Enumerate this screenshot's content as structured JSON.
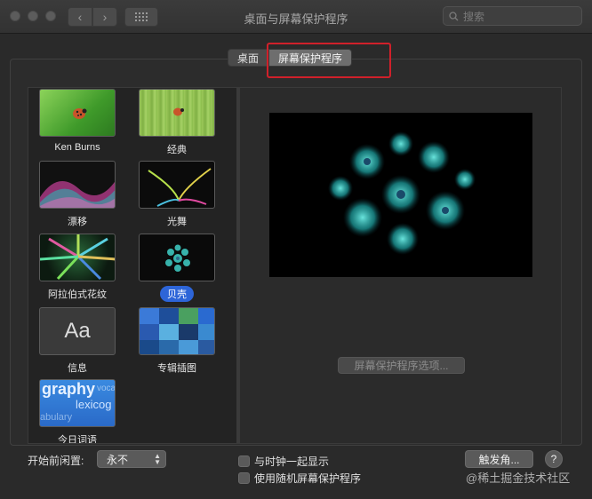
{
  "window": {
    "title": "桌面与屏幕保护程序",
    "search_placeholder": "搜索"
  },
  "tabs": [
    {
      "label": "桌面",
      "selected": false
    },
    {
      "label": "屏幕保护程序",
      "selected": true
    }
  ],
  "screensavers": [
    {
      "label": "Ken Burns",
      "selected": false
    },
    {
      "label": "经典",
      "selected": false
    },
    {
      "label": "漂移",
      "selected": false
    },
    {
      "label": "光舞",
      "selected": false
    },
    {
      "label": "阿拉伯式花纹",
      "selected": false
    },
    {
      "label": "贝壳",
      "selected": true
    },
    {
      "label": "信息",
      "selected": false
    },
    {
      "label": "专辑插图",
      "selected": false
    },
    {
      "label": "今日词语",
      "selected": false
    }
  ],
  "thumb_text": {
    "message": "Aa",
    "word1": "graphy",
    "word2": "lexicog",
    "word3": "abulary",
    "word4": "voca"
  },
  "preview": {
    "options_button": "屏幕保护程序选项..."
  },
  "footer": {
    "idle_label": "开始前闲置:",
    "idle_value": "永不",
    "show_clock": "与时钟一起显示",
    "random_saver": "使用随机屏幕保护程序",
    "hot_corners": "触发角...",
    "help": "?"
  },
  "watermark": "@稀土掘金技术社区",
  "colors": {
    "accent": "#2d65d8",
    "highlight_box": "#d0202a"
  }
}
